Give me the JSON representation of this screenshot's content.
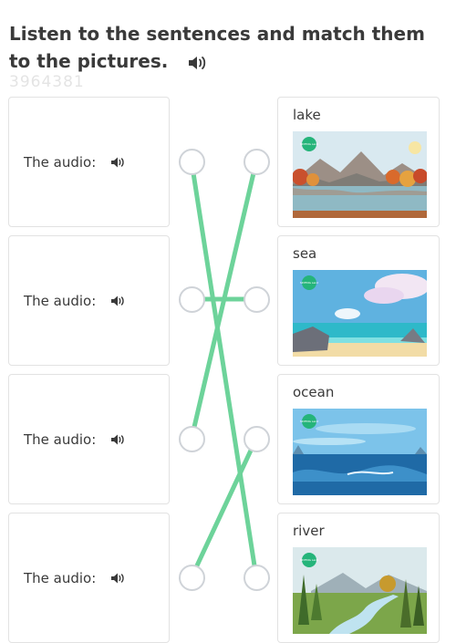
{
  "header": {
    "title": "Listen to the sentences and match them to the pictures.",
    "watermark": "3964381",
    "speaker_icon": "speaker-icon"
  },
  "left_items": [
    {
      "label": "The audio:"
    },
    {
      "label": "The audio:"
    },
    {
      "label": "The audio:"
    },
    {
      "label": "The audio:"
    }
  ],
  "right_items": [
    {
      "word": "lake",
      "picture": "lake-landscape-image"
    },
    {
      "word": "sea",
      "picture": "sea-landscape-image"
    },
    {
      "word": "ocean",
      "picture": "ocean-landscape-image"
    },
    {
      "word": "river",
      "picture": "river-landscape-image"
    }
  ],
  "picture_badge": "SKYENG Land",
  "colors": {
    "connector_line": "#6dd39a",
    "dot_border": "#cfd3d8",
    "card_border": "#e2e2e2",
    "badge": "#25b47a"
  }
}
